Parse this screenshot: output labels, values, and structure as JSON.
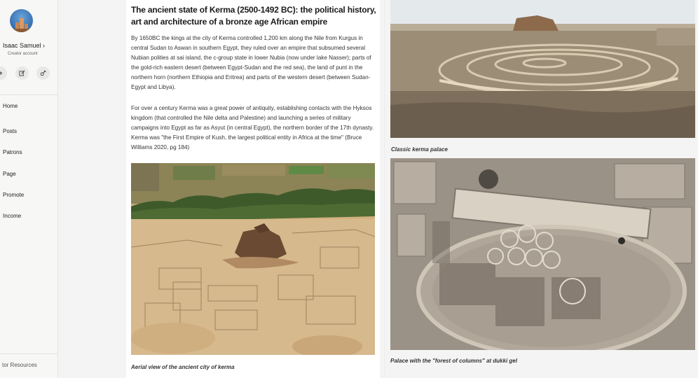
{
  "sidebar": {
    "user_name": "Isaac Samuel ›",
    "user_subtitle": "Creator account",
    "icons": [
      "chevron-icon",
      "compose-icon",
      "link-icon"
    ],
    "nav": [
      {
        "label": "Home"
      },
      {
        "label": "Posts"
      },
      {
        "label": "Patrons"
      },
      {
        "label": "Page"
      },
      {
        "label": "Promote"
      },
      {
        "label": "Income"
      }
    ],
    "footer_link": "tor Resources"
  },
  "article": {
    "title": "The ancient state of Kerma (2500-1492 BC): the political history, art and architecture of a bronze age African empire",
    "paragraph1": "By 1650BC the kings at the city of Kerma controlled 1,200 km along the Nile from Kurgus in central Sudan to Aswan in southern Egypt, they ruled over an empire that subsumed several Nubian polities at sai island, the c-group state in lower Nubia (now under lake Nasser); parts of the gold-rich eastern desert (between Egypt-Sudan and the red sea), the land of punt in the northern horn (northern Ethiopia and Eritrea) and parts of the western desert (between Sudan-Egypt and Libya).",
    "paragraph2": "For over a century Kerma was a great power of antiquity, establishing contacts with the Hyksos kingdom (that controlled the Nile delta and Palestine) and launching a series of military campaigns into Egypt as far as Asyut (in central Egypt), the northern border of the 17th dynasty. Kerma was \"the First Empire of Kush, the largest political entity in Africa at the time\" (Bruce Williams 2020, pg 184)",
    "image_caption": "Aerial view of the ancient city of kerma"
  },
  "right_column": {
    "caption1": "Classic kerma palace",
    "caption2": "Palace with the \"forest of columns\" at dukki gel"
  },
  "colors": {
    "sidebar_bg": "#f7f7f5",
    "page_bg": "#f4f4f4",
    "text": "#222222"
  }
}
